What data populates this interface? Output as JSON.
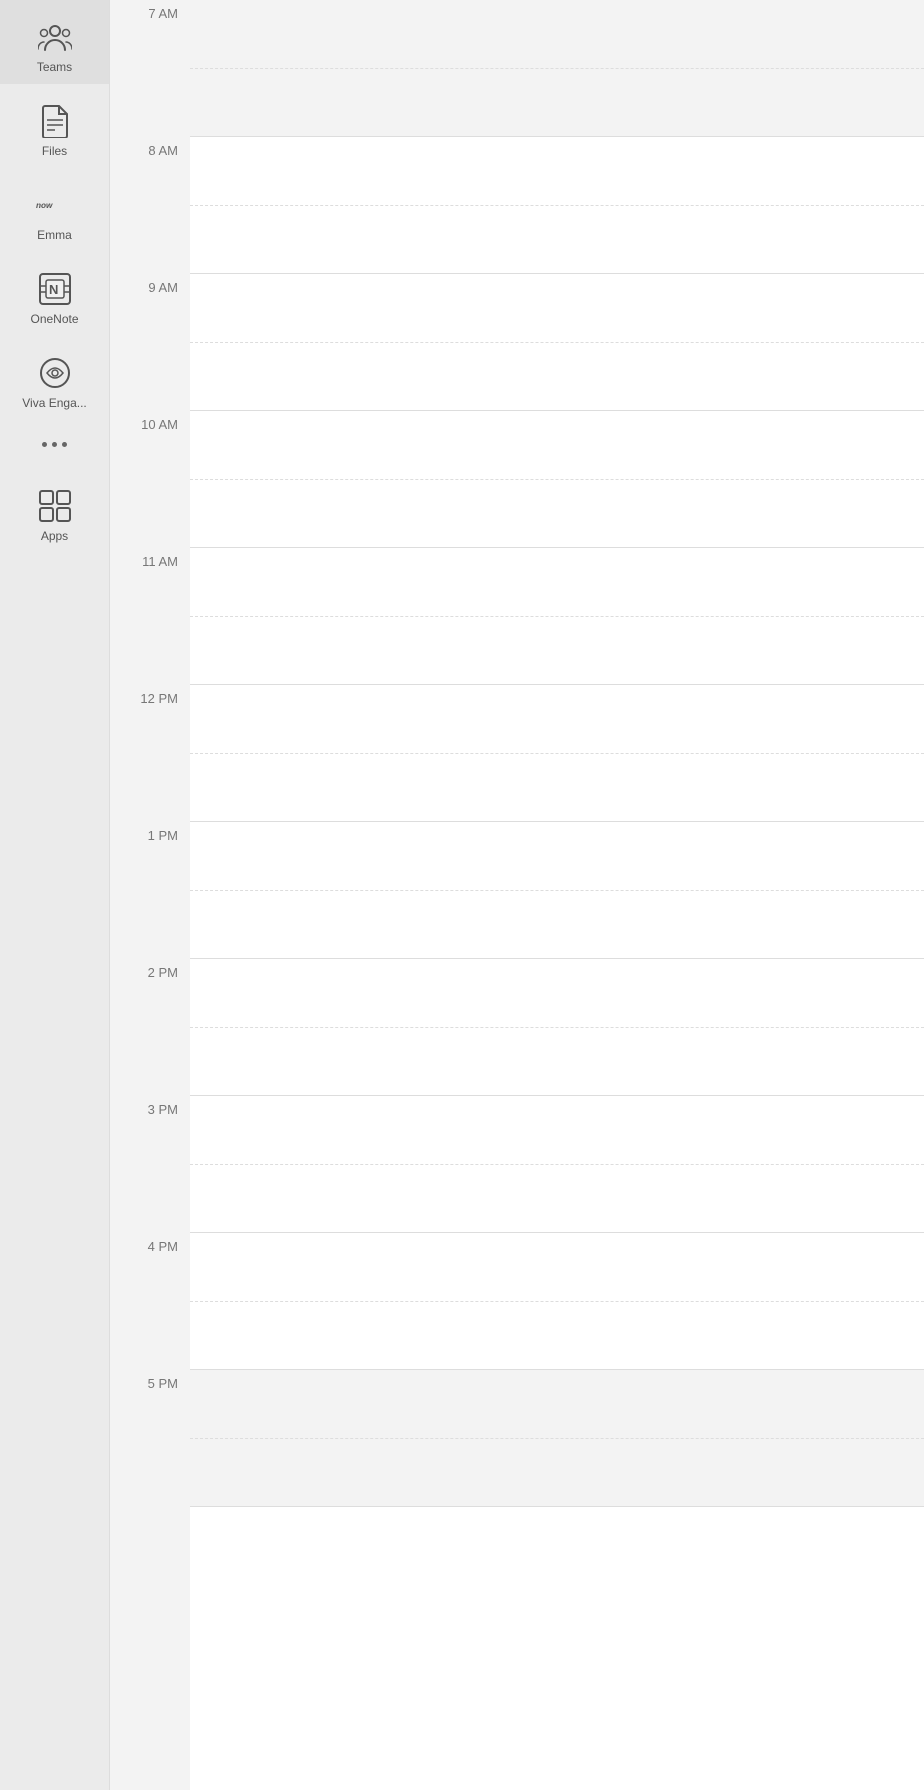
{
  "sidebar": {
    "items": [
      {
        "id": "teams",
        "label": "Teams",
        "icon": "teams-icon"
      },
      {
        "id": "files",
        "label": "Files",
        "icon": "files-icon"
      },
      {
        "id": "emma",
        "label": "Emma",
        "sublabel": "now",
        "icon": "emma-icon"
      },
      {
        "id": "onenote",
        "label": "OneNote",
        "icon": "onenote-icon"
      },
      {
        "id": "viva-engage",
        "label": "Viva Enga...",
        "icon": "viva-engage-icon"
      },
      {
        "id": "apps",
        "label": "Apps",
        "icon": "apps-icon"
      }
    ],
    "more_label": "..."
  },
  "calendar": {
    "time_slots": [
      {
        "label": "7 AM",
        "shaded": true
      },
      {
        "label": "8 AM",
        "shaded": false
      },
      {
        "label": "9 AM",
        "shaded": false
      },
      {
        "label": "10 AM",
        "shaded": false
      },
      {
        "label": "11 AM",
        "shaded": false
      },
      {
        "label": "12 PM",
        "shaded": false
      },
      {
        "label": "1 PM",
        "shaded": false
      },
      {
        "label": "2 PM",
        "shaded": false
      },
      {
        "label": "3 PM",
        "shaded": false
      },
      {
        "label": "4 PM",
        "shaded": false
      },
      {
        "label": "5 PM",
        "shaded": true
      }
    ]
  }
}
